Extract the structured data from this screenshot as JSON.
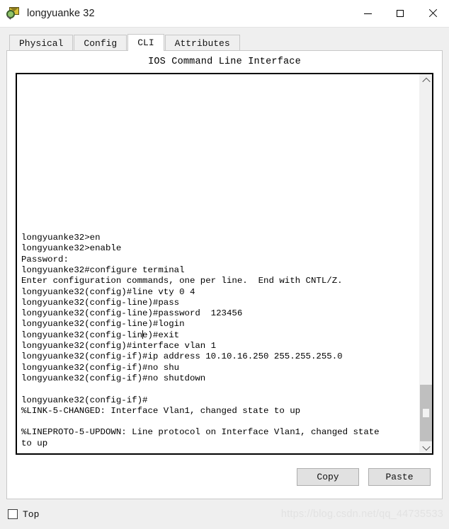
{
  "window": {
    "title": "longyuanke 32",
    "icon": "packet-tracer-switch-icon",
    "controls": {
      "minimize": "—",
      "maximize": "□",
      "close": "×"
    }
  },
  "tabs": [
    {
      "label": "Physical",
      "active": false
    },
    {
      "label": "Config",
      "active": false
    },
    {
      "label": "CLI",
      "active": true
    },
    {
      "label": "Attributes",
      "active": false
    }
  ],
  "panel": {
    "title": "IOS Command Line Interface"
  },
  "terminal": {
    "lines": [
      "longyuanke32>en",
      "longyuanke32>enable",
      "Password:",
      "longyuanke32#configure terminal",
      "Enter configuration commands, one per line.  End with CNTL/Z.",
      "longyuanke32(config)#line vty 0 4",
      "longyuanke32(config-line)#pass",
      "longyuanke32(config-line)#password  123456",
      "longyuanke32(config-line)#login",
      "longyuanke32(config-line)#exit",
      "longyuanke32(config)#interface vlan 1",
      "longyuanke32(config-if)#ip address 10.10.16.250 255.255.255.0",
      "longyuanke32(config-if)#no shu",
      "longyuanke32(config-if)#no shutdown",
      "",
      "longyuanke32(config-if)#",
      "%LINK-5-CHANGED: Interface Vlan1, changed state to up",
      "",
      "%LINEPROTO-5-UPDOWN: Line protocol on Interface Vlan1, changed state",
      "to up"
    ],
    "caret_line_index": 9,
    "caret_column": 23,
    "scrollbar": {
      "up_arrow": "chevron-up",
      "down_arrow": "chevron-down",
      "thumb_top_pct": 84,
      "thumb_height_pct": 16
    }
  },
  "actions": {
    "copy_label": "Copy",
    "paste_label": "Paste"
  },
  "footer": {
    "top_checkbox_label": "Top",
    "top_checkbox_checked": false,
    "watermark": "https://blog.csdn.net/qq_44735533"
  },
  "colors": {
    "window_bg": "#efefef",
    "panel_bg": "#ffffff",
    "terminal_border": "#000000",
    "button_bg": "#e1e1e1",
    "scrollbar_thumb": "#bfbfbf",
    "watermark": "#e2e2e2"
  }
}
